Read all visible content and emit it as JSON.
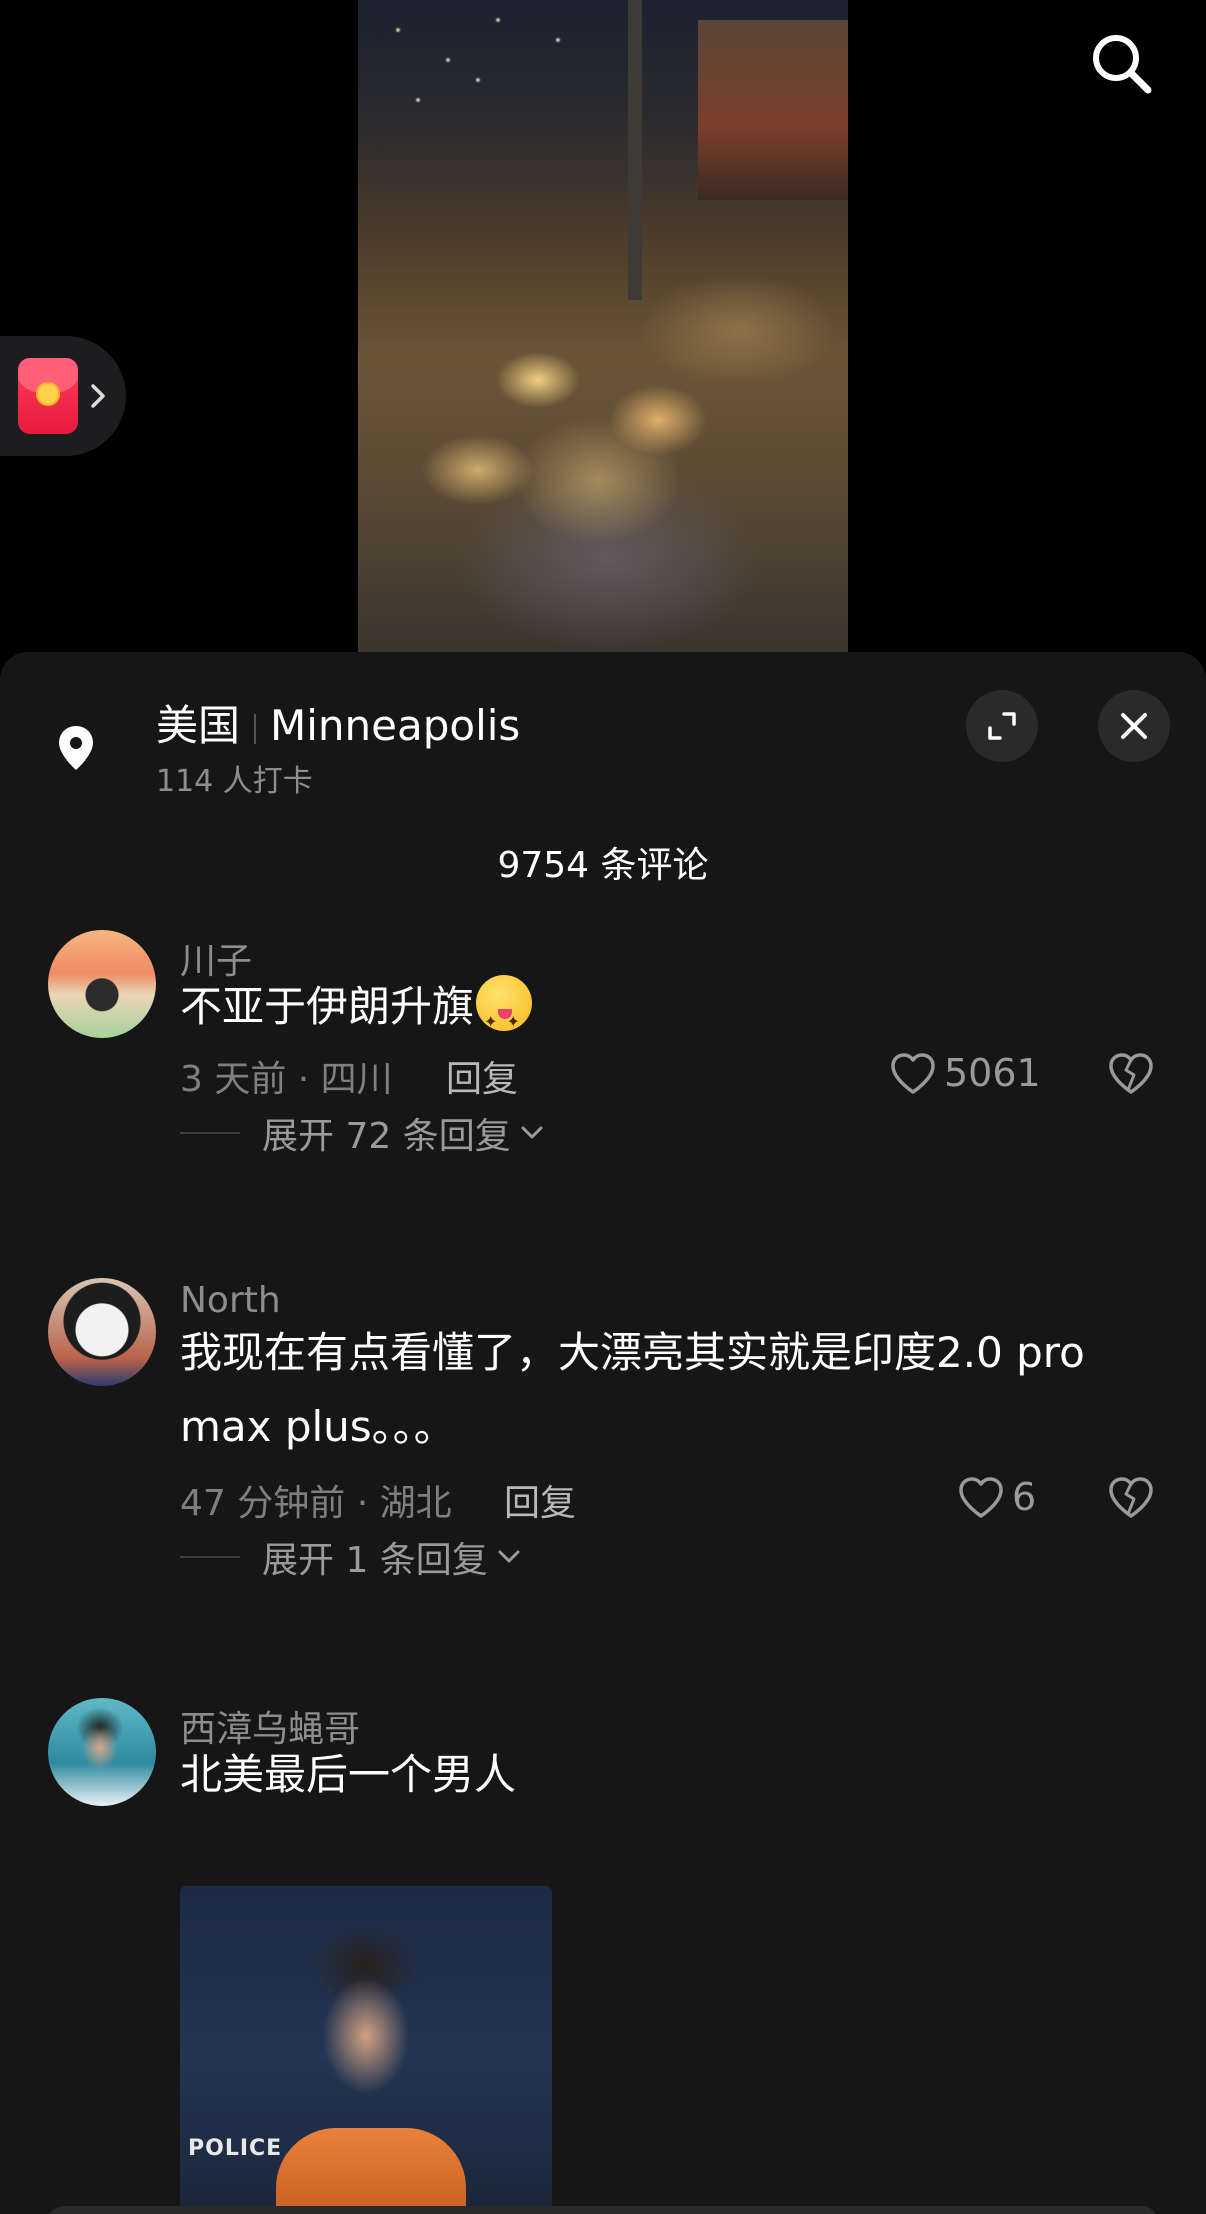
{
  "location": {
    "country": "美国",
    "city": "Minneapolis",
    "checkins": "114 人打卡"
  },
  "comments_header": {
    "count_label": "9754 条评论"
  },
  "comments": [
    {
      "username": "川子",
      "text": "不亚于伊朗升旗",
      "emoji": "crazy-face-emoji",
      "meta": "3 天前 · 四川",
      "reply_label": "回复",
      "likes": "5061",
      "expand_label": "展开 72 条回复"
    },
    {
      "username": "North",
      "text": "我现在有点看懂了，大漂亮其实就是印度2.0 pro max plus。。。",
      "meta": "47 分钟前 · 湖北",
      "reply_label": "回复",
      "likes": "6",
      "expand_label": "展开 1 条回复"
    },
    {
      "username": "西漳乌蝇哥",
      "text": "北美最后一个男人",
      "image_text": "POLICE"
    }
  ],
  "icons": {
    "search": "search-icon",
    "red_packet": "red-packet-icon",
    "location": "location-pin-icon",
    "expand": "expand-icon",
    "close": "close-icon",
    "like": "heart-outline-icon",
    "dislike": "broken-heart-icon",
    "chevron": "chevron-down-icon"
  },
  "colors": {
    "sheet_bg": "#161616",
    "secondary_text": "#8d8d8d",
    "red_packet": "#e8193c"
  }
}
